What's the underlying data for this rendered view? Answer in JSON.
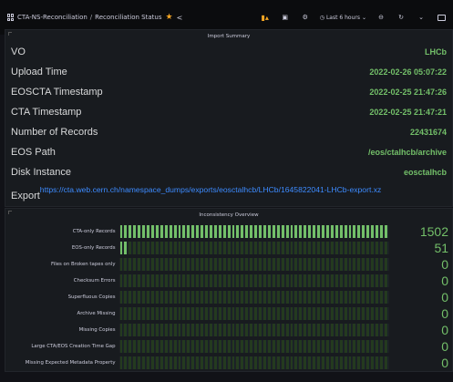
{
  "header": {
    "breadcrumb_folder": "CTA-NS-Reconciliation",
    "breadcrumb_separator": "/",
    "dashboard_title": "Reconciliation Status",
    "time_range": "Last 6 hours",
    "icons": [
      "apps-icon",
      "star-icon",
      "share-icon",
      "add-panel-icon",
      "save-icon",
      "settings-icon",
      "clock-icon",
      "chevron-down-icon",
      "zoom-out-icon",
      "refresh-icon",
      "chevron-down-icon",
      "tv-icon"
    ],
    "accent_color": "#f5a623"
  },
  "import_summary": {
    "title": "Import Summary",
    "rows": [
      {
        "label": "VO",
        "value": "LHCb"
      },
      {
        "label": "Upload Time",
        "value": "2022-02-26 05:07:22"
      },
      {
        "label": "EOSCTA Timestamp",
        "value": "2022-02-25 21:47:26"
      },
      {
        "label": "CTA Timestamp",
        "value": "2022-02-25 21:47:21"
      },
      {
        "label": "Number of Records",
        "value": "22431674"
      },
      {
        "label": "EOS Path",
        "value": "/eos/ctalhcb/archive"
      },
      {
        "label": "Disk Instance",
        "value": "eosctalhcb"
      }
    ],
    "export_label": "Export",
    "export_link": "https://cta.web.cern.ch/namespace_dumps/exports/eosctalhcb/LHCb/1645822041-LHCb-export.xz",
    "value_color": "#73bf69",
    "link_color": "#3d8bff"
  },
  "inconsistency_overview": {
    "title": "Inconsistency Overview",
    "bar_color": "#73bf69",
    "rows": [
      {
        "label": "CTA-only Records",
        "value": "1502",
        "fill": 1.0
      },
      {
        "label": "EOS-only Records",
        "value": "51",
        "fill": 0.034
      },
      {
        "label": "Files on Broken tapes only",
        "value": "0",
        "fill": 0
      },
      {
        "label": "Checksum Errors",
        "value": "0",
        "fill": 0
      },
      {
        "label": "Superfluous Copies",
        "value": "0",
        "fill": 0
      },
      {
        "label": "Archive Missing",
        "value": "0",
        "fill": 0
      },
      {
        "label": "Missing Copies",
        "value": "0",
        "fill": 0
      },
      {
        "label": "Large CTA/EOS Creation Time Gap",
        "value": "0",
        "fill": 0
      },
      {
        "label": "Missing Expected Metadata Property",
        "value": "0",
        "fill": 0
      }
    ]
  }
}
